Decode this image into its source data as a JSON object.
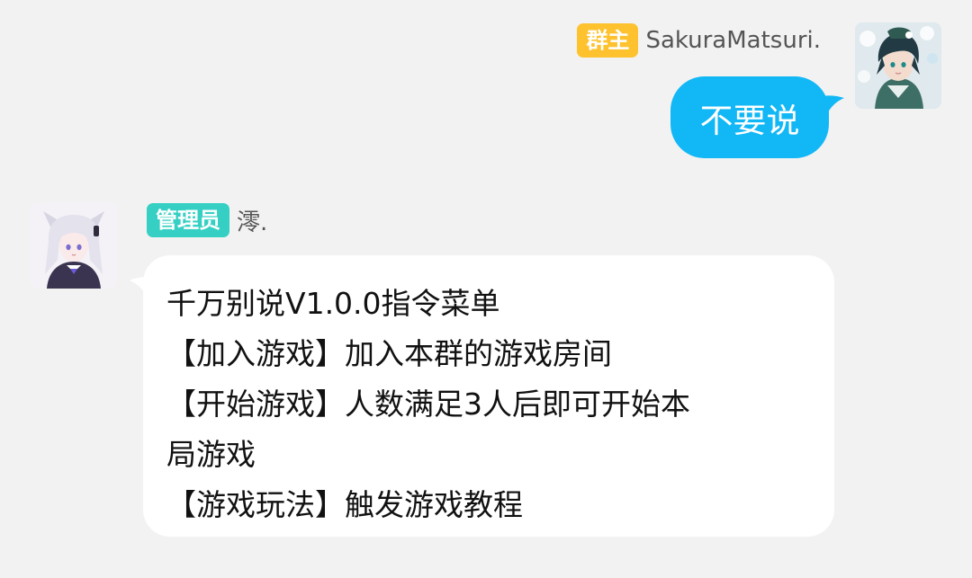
{
  "messages": {
    "outgoing": {
      "role_badge": "群主",
      "sender": "SakuraMatsuri.",
      "text": "不要说",
      "bubble_color": "#12b7f5",
      "badge_color": "#fdc22e"
    },
    "incoming": {
      "role_badge": "管理员",
      "sender": "澪.",
      "bubble_color": "#ffffff",
      "badge_color": "#35d0c3",
      "lines": [
        "千万别说V1.0.0指令菜单",
        "【加入游戏】加入本群的游戏房间",
        "【开始游戏】人数满足3人后即可开始本",
        "局游戏",
        "【游戏玩法】触发游戏教程"
      ]
    }
  },
  "theme": {
    "background": "#f2f2f2"
  },
  "icons": {
    "outgoing_avatar": "avatar-green-hair-character",
    "incoming_avatar": "avatar-silver-hair-catgirl"
  }
}
